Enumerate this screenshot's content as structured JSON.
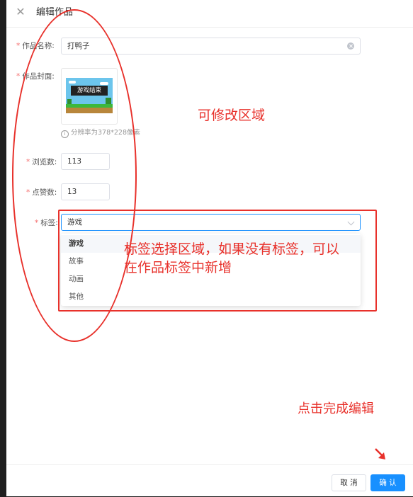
{
  "header": {
    "close_icon": "close-icon",
    "title": "编辑作品"
  },
  "form": {
    "name": {
      "label": "作品名称:",
      "value": "打鸭子"
    },
    "cover": {
      "label": "作品封面:",
      "image_text": "游戏结束",
      "hint": "分辨率为378*228像素"
    },
    "views": {
      "label": "浏览数:",
      "value": "113"
    },
    "likes": {
      "label": "点赞数:",
      "value": "13"
    },
    "tags": {
      "label": "标签:",
      "selected": "游戏",
      "options": [
        "游戏",
        "故事",
        "动画",
        "其他"
      ]
    }
  },
  "annotations": {
    "editable_area": "可修改区域",
    "tag_area_line1": "标签选择区域，如果没有标签，可以",
    "tag_area_line2": "在作品标签中新增",
    "finish": "点击完成编辑"
  },
  "footer": {
    "cancel_label": "取 消",
    "confirm_label": "确 认"
  },
  "colors": {
    "primary": "#1890ff",
    "annotation_red": "#e8312b",
    "required": "#f56c6c"
  }
}
